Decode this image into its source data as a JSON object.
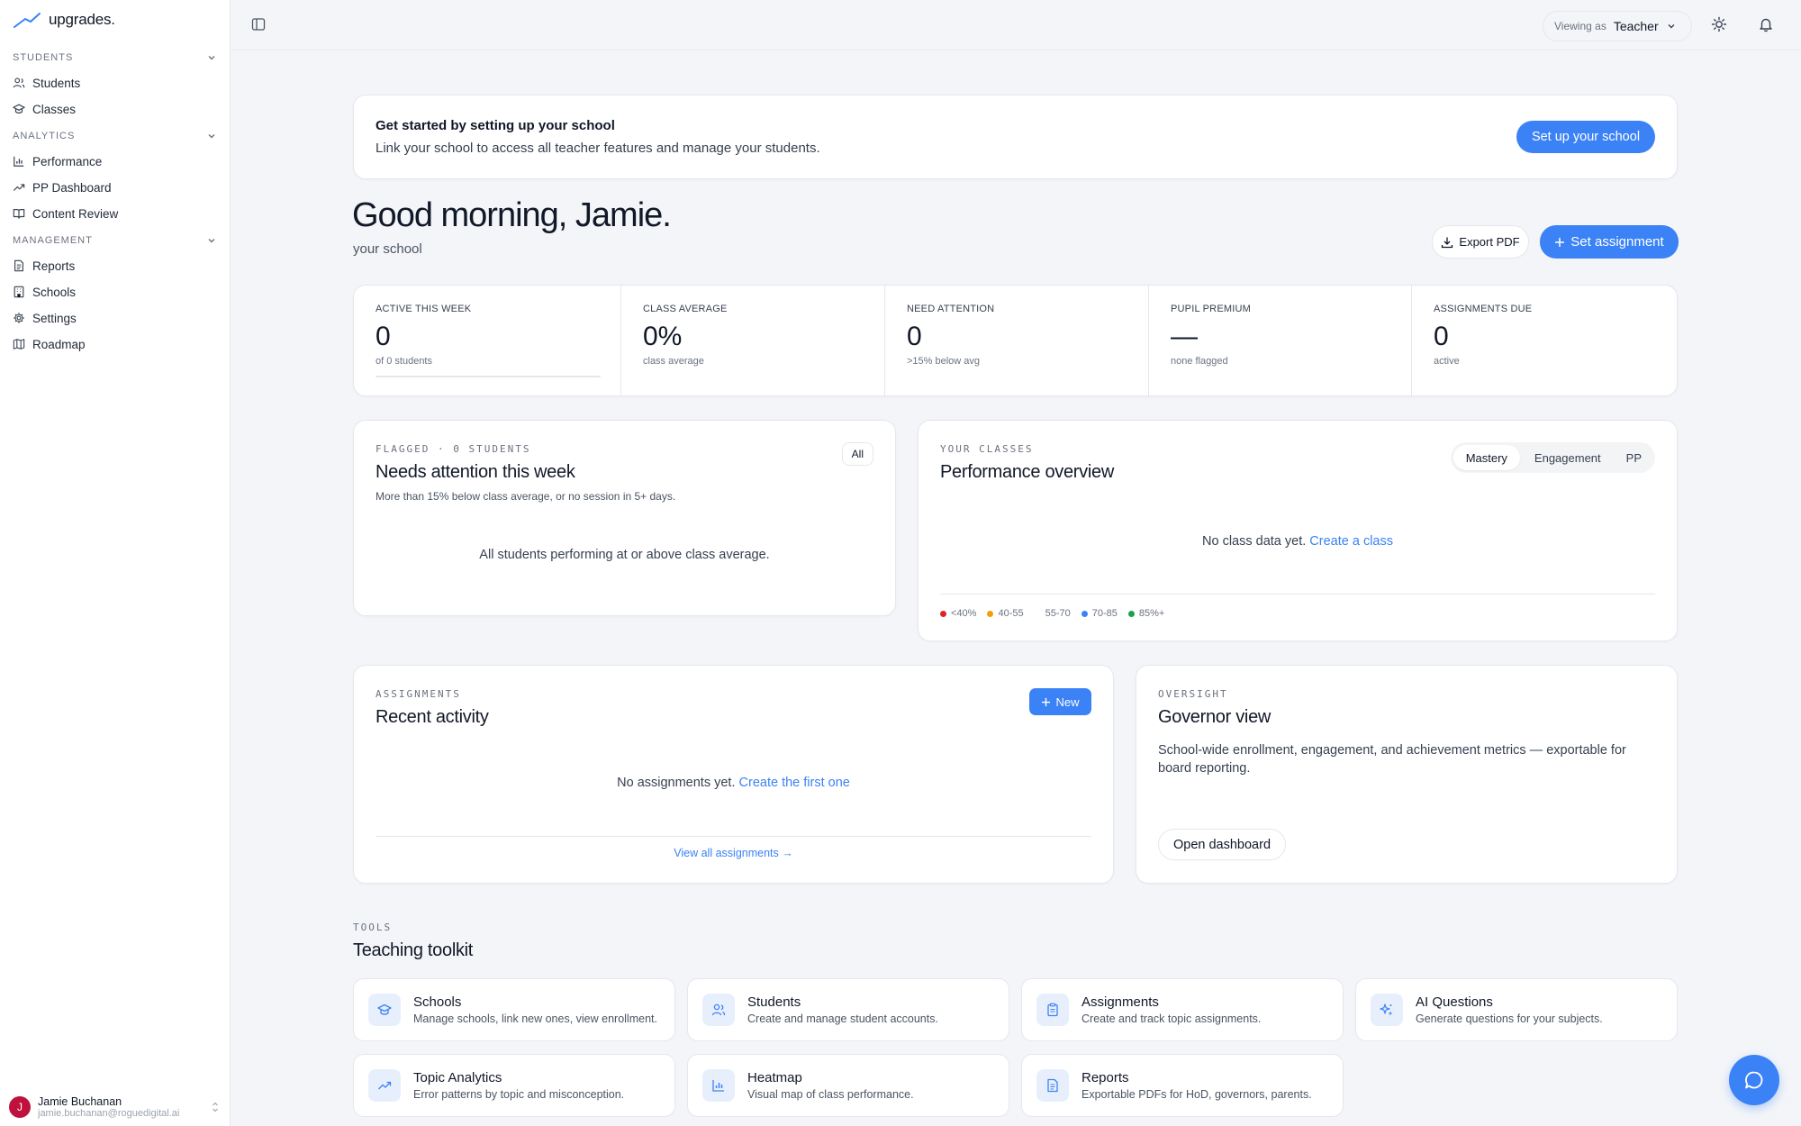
{
  "app": {
    "name": "upgrades."
  },
  "sidebar": {
    "sections": [
      {
        "title": "STUDENTS",
        "items": [
          {
            "label": "Students",
            "icon": "users-icon"
          },
          {
            "label": "Classes",
            "icon": "graduation-cap-icon"
          }
        ]
      },
      {
        "title": "ANALYTICS",
        "items": [
          {
            "label": "Performance",
            "icon": "bar-chart-icon"
          },
          {
            "label": "PP Dashboard",
            "icon": "trending-up-icon"
          },
          {
            "label": "Content Review",
            "icon": "book-open-icon"
          }
        ]
      },
      {
        "title": "MANAGEMENT",
        "items": [
          {
            "label": "Reports",
            "icon": "file-text-icon"
          },
          {
            "label": "Schools",
            "icon": "building-icon"
          },
          {
            "label": "Settings",
            "icon": "gear-icon"
          },
          {
            "label": "Roadmap",
            "icon": "map-icon"
          }
        ]
      }
    ],
    "user": {
      "initial": "J",
      "name": "Jamie Buchanan",
      "email": "jamie.buchanan@roguedigital.ai"
    }
  },
  "topbar": {
    "viewing_label": "Viewing as",
    "viewing_value": "Teacher"
  },
  "banner": {
    "title": "Get started by setting up your school",
    "subtitle": "Link your school to access all teacher features and manage your students.",
    "button": "Set up your school"
  },
  "greeting": {
    "title": "Good morning, Jamie.",
    "subtitle": "your school",
    "export_label": "Export PDF",
    "assign_label": "Set assignment"
  },
  "stats": [
    {
      "label": "ACTIVE THIS WEEK",
      "value": "0",
      "sub": "of 0 students",
      "progress": 0
    },
    {
      "label": "CLASS AVERAGE",
      "value": "0%",
      "sub": "class average"
    },
    {
      "label": "NEED ATTENTION",
      "value": "0",
      "sub": ">15% below avg"
    },
    {
      "label": "PUPIL PREMIUM",
      "value": "—",
      "sub": "none flagged"
    },
    {
      "label": "ASSIGNMENTS DUE",
      "value": "0",
      "sub": "active"
    }
  ],
  "attention": {
    "eyebrow": "FLAGGED · 0 STUDENTS",
    "title": "Needs attention this week",
    "subtitle": "More than 15% below class average, or no session in 5+ days.",
    "filter": "All",
    "empty": "All students performing at or above class average."
  },
  "classes": {
    "eyebrow": "YOUR CLASSES",
    "title": "Performance overview",
    "tabs": [
      "Mastery",
      "Engagement",
      "PP"
    ],
    "active_tab": "Mastery",
    "empty_text": "No class data yet.",
    "empty_link": "Create a class",
    "legend": [
      {
        "label": "<40%",
        "color": "#dc2626"
      },
      {
        "label": "40-55",
        "color": "#f59e0b"
      },
      {
        "label": "55-70",
        "color": "#ffffff"
      },
      {
        "label": "70-85",
        "color": "#3b82f6"
      },
      {
        "label": "85%+",
        "color": "#16a34a"
      }
    ]
  },
  "assignments": {
    "eyebrow": "ASSIGNMENTS",
    "title": "Recent activity",
    "new_label": "New",
    "empty_text": "No assignments yet.",
    "empty_link": "Create the first one",
    "view_all": "View all assignments →"
  },
  "oversight": {
    "eyebrow": "OVERSIGHT",
    "title": "Governor view",
    "description": "School-wide enrollment, engagement, and achievement metrics — exportable for board reporting.",
    "button": "Open dashboard"
  },
  "toolkit": {
    "eyebrow": "TOOLS",
    "title": "Teaching toolkit",
    "tools": [
      {
        "title": "Schools",
        "desc": "Manage schools, link new ones, view enrollment.",
        "icon": "graduation-cap-icon"
      },
      {
        "title": "Students",
        "desc": "Create and manage student accounts.",
        "icon": "users-icon"
      },
      {
        "title": "Assignments",
        "desc": "Create and track topic assignments.",
        "icon": "clipboard-icon"
      },
      {
        "title": "AI Questions",
        "desc": "Generate questions for your subjects.",
        "icon": "sparkles-icon"
      },
      {
        "title": "Topic Analytics",
        "desc": "Error patterns by topic and misconception.",
        "icon": "trending-up-icon"
      },
      {
        "title": "Heatmap",
        "desc": "Visual map of class performance.",
        "icon": "bar-chart-icon"
      },
      {
        "title": "Reports",
        "desc": "Exportable PDFs for HoD, governors, parents.",
        "icon": "file-text-icon"
      }
    ]
  },
  "colors": {
    "accent": "#3b82f6",
    "background": "#f3f5f8"
  }
}
